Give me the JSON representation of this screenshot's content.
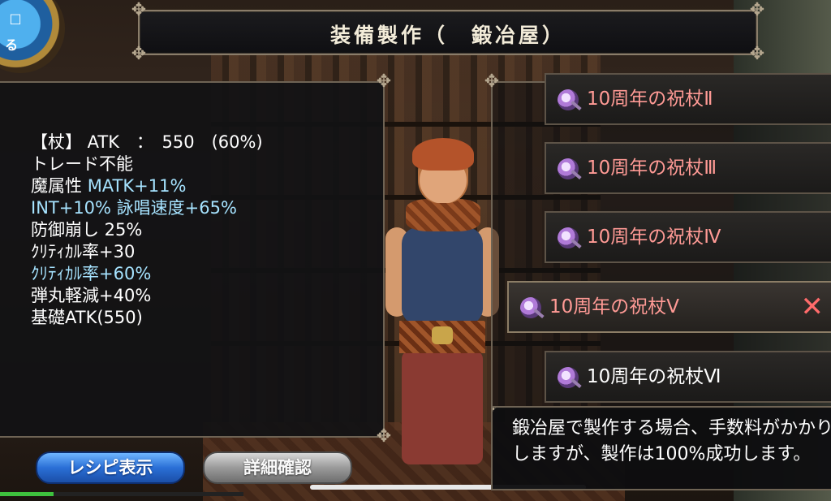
{
  "header": {
    "title": "装備製作（　鍛冶屋）"
  },
  "menu_orb": {
    "glyph": "□",
    "text": "る",
    "icon": "menu-orb-icon"
  },
  "stats": {
    "lines": [
      {
        "text": "【杖】 ATK　：　550　(60%)",
        "color": "white"
      },
      {
        "text": "トレード不能",
        "color": "white"
      },
      {
        "parts": [
          {
            "text": "魔属性 ",
            "color": "white"
          },
          {
            "text": "MATK+11%",
            "color": "cyan"
          }
        ]
      },
      {
        "parts": [
          {
            "text": "INT+10% 詠唱速度+65%",
            "color": "cyan"
          }
        ]
      },
      {
        "text": "防御崩し 25%",
        "color": "white"
      },
      {
        "text": "ｸﾘﾃｨｶﾙ率+30",
        "color": "white"
      },
      {
        "text": "ｸﾘﾃｨｶﾙ率+60%",
        "color": "cyan"
      },
      {
        "text": "弾丸軽減+40%",
        "color": "white"
      },
      {
        "text": "基礎ATK(550)",
        "color": "white"
      }
    ]
  },
  "buttons": {
    "recipe_label": "レシピ表示",
    "detail_label": "詳細確認"
  },
  "progress_fraction": 0.22,
  "recipes": [
    {
      "label": "10周年の祝杖Ⅱ",
      "state": "unavailable"
    },
    {
      "label": "10周年の祝杖Ⅲ",
      "state": "unavailable"
    },
    {
      "label": "10周年の祝杖Ⅳ",
      "state": "unavailable"
    },
    {
      "label": "10周年の祝杖Ⅴ",
      "state": "selected",
      "close": "✕"
    },
    {
      "label": "10周年の祝杖Ⅵ",
      "state": "available"
    }
  ],
  "message": {
    "line1": "鍛冶屋で製作する場合、手数料がかかり",
    "line2": "しますが、製作は100%成功します。"
  },
  "colors": {
    "cyan_text": "#a6e3ff",
    "red_text": "#ff9a95",
    "recipe_button": "#2a6fd6",
    "detail_button": "#9a9a9a"
  }
}
